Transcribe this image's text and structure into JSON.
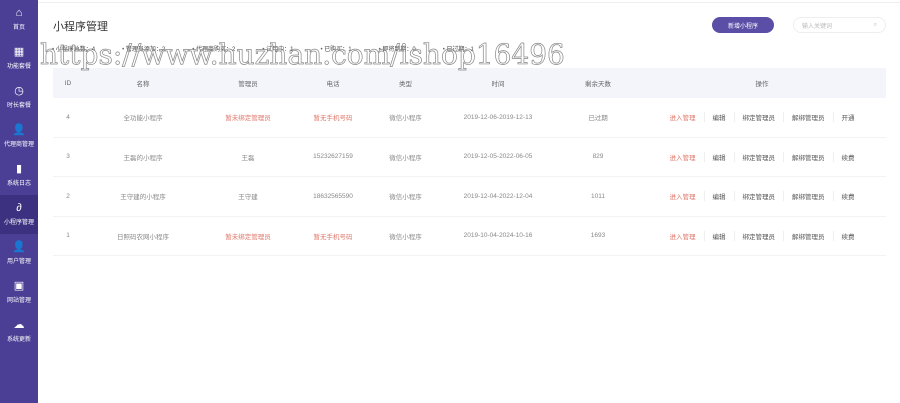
{
  "sidebar": {
    "items": [
      {
        "label": "首页",
        "icon": "home-icon"
      },
      {
        "label": "功能套餐",
        "icon": "grid-icon"
      },
      {
        "label": "时长套餐",
        "icon": "clock-icon"
      },
      {
        "label": "代理商管理",
        "icon": "agent-icon"
      },
      {
        "label": "系统日志",
        "icon": "book-icon"
      },
      {
        "label": "小程序管理",
        "icon": "miniapp-icon",
        "active": true
      },
      {
        "label": "用户管理",
        "icon": "user-icon"
      },
      {
        "label": "网站管理",
        "icon": "site-icon"
      },
      {
        "label": "系统更新",
        "icon": "cloud-icon"
      }
    ]
  },
  "header": {
    "title": "小程序管理",
    "add_button": "新增小程序",
    "search_placeholder": "输入关键词"
  },
  "stats": [
    "小程序总数：4",
    "管理员添加：2",
    "代理商购买：2",
    "试用中：1",
    "已购买：1",
    "即将到期：0",
    "已过期：1"
  ],
  "table": {
    "columns": [
      "ID",
      "名称",
      "管理员",
      "电话",
      "类型",
      "时间",
      "剩余天数",
      "操作"
    ],
    "rows": [
      {
        "id": "4",
        "name": "全功能小程序",
        "admin": "暂未绑定管理员",
        "phone": "暂无手机号码",
        "type": "微信小程序",
        "time": "2019-12-06-2019-12-13",
        "days": "已过期",
        "ops": [
          "进入管理",
          "编辑",
          "绑定管理员",
          "解绑管理员",
          "开通"
        ]
      },
      {
        "id": "3",
        "name": "王磊的小程序",
        "admin": "王磊",
        "phone": "15232627159",
        "type": "微信小程序",
        "time": "2019-12-05-2022-06-05",
        "days": "829",
        "ops": [
          "进入管理",
          "编辑",
          "绑定管理员",
          "解绑管理员",
          "续费"
        ]
      },
      {
        "id": "2",
        "name": "王守建的小程序",
        "admin": "王守建",
        "phone": "18632565590",
        "type": "微信小程序",
        "time": "2019-12-04-2022-12-04",
        "days": "1011",
        "ops": [
          "进入管理",
          "编辑",
          "绑定管理员",
          "解绑管理员",
          "续费"
        ]
      },
      {
        "id": "1",
        "name": "日照码农网小程序",
        "admin": "暂未绑定管理员",
        "phone": "暂无手机号码",
        "type": "微信小程序",
        "time": "2019-10-04-2024-10-16",
        "days": "1693",
        "ops": [
          "进入管理",
          "编辑",
          "绑定管理员",
          "解绑管理员",
          "续费"
        ]
      }
    ]
  },
  "watermark": "https://www.huzhan.com/ishop16496"
}
